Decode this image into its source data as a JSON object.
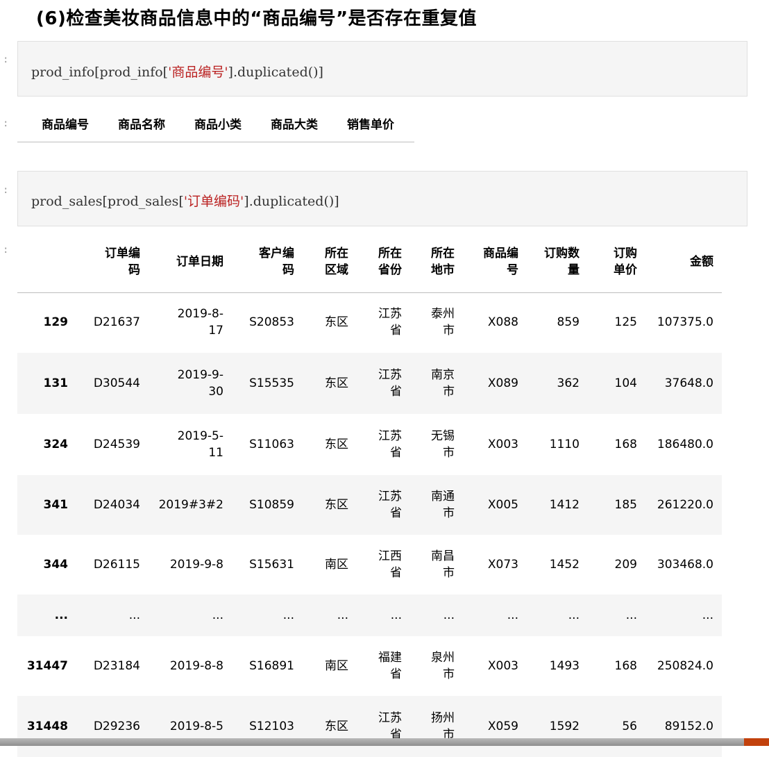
{
  "heading": "(6)检查美妆商品信息中的“商品编号”是否存在重复值",
  "prompt_mark": ":",
  "cell1": {
    "prefix": "prod_info[prod_info[",
    "string": "'商品编号'",
    "suffix": "].duplicated()]"
  },
  "output1": {
    "columns": [
      "商品编号",
      "商品名称",
      "商品小类",
      "商品大类",
      "销售单价"
    ]
  },
  "cell2": {
    "prefix": "prod_sales[prod_sales[",
    "string": "'订单编码'",
    "suffix": "].duplicated()]"
  },
  "output2": {
    "headers": [
      [
        "订单编",
        "码"
      ],
      [
        "订单日期"
      ],
      [
        "客户编",
        "码"
      ],
      [
        "所在",
        "区域"
      ],
      [
        "所在",
        "省份"
      ],
      [
        "所在",
        "地市"
      ],
      [
        "商品编",
        "号"
      ],
      [
        "订购数",
        "量"
      ],
      [
        "订购",
        "单价"
      ],
      [
        "金额"
      ]
    ],
    "rows": [
      {
        "index": "129",
        "cells": [
          [
            "D21637"
          ],
          [
            "2019-8-",
            "17"
          ],
          [
            "S20853"
          ],
          [
            "东区"
          ],
          [
            "江苏",
            "省"
          ],
          [
            "泰州",
            "市"
          ],
          [
            "X088"
          ],
          [
            "859"
          ],
          [
            "125"
          ],
          [
            "107375.0"
          ]
        ]
      },
      {
        "index": "131",
        "cells": [
          [
            "D30544"
          ],
          [
            "2019-9-",
            "30"
          ],
          [
            "S15535"
          ],
          [
            "东区"
          ],
          [
            "江苏",
            "省"
          ],
          [
            "南京",
            "市"
          ],
          [
            "X089"
          ],
          [
            "362"
          ],
          [
            "104"
          ],
          [
            "37648.0"
          ]
        ]
      },
      {
        "index": "324",
        "cells": [
          [
            "D24539"
          ],
          [
            "2019-5-",
            "11"
          ],
          [
            "S11063"
          ],
          [
            "东区"
          ],
          [
            "江苏",
            "省"
          ],
          [
            "无锡",
            "市"
          ],
          [
            "X003"
          ],
          [
            "1110"
          ],
          [
            "168"
          ],
          [
            "186480.0"
          ]
        ]
      },
      {
        "index": "341",
        "cells": [
          [
            "D24034"
          ],
          [
            "2019#3#2"
          ],
          [
            "S10859"
          ],
          [
            "东区"
          ],
          [
            "江苏",
            "省"
          ],
          [
            "南通",
            "市"
          ],
          [
            "X005"
          ],
          [
            "1412"
          ],
          [
            "185"
          ],
          [
            "261220.0"
          ]
        ]
      },
      {
        "index": "344",
        "cells": [
          [
            "D26115"
          ],
          [
            "2019-9-8"
          ],
          [
            "S15631"
          ],
          [
            "南区"
          ],
          [
            "江西",
            "省"
          ],
          [
            "南昌",
            "市"
          ],
          [
            "X073"
          ],
          [
            "1452"
          ],
          [
            "209"
          ],
          [
            "303468.0"
          ]
        ]
      },
      {
        "index": "...",
        "cells": [
          [
            "..."
          ],
          [
            "..."
          ],
          [
            "..."
          ],
          [
            "..."
          ],
          [
            "..."
          ],
          [
            "..."
          ],
          [
            "..."
          ],
          [
            "..."
          ],
          [
            "..."
          ],
          [
            "..."
          ]
        ]
      },
      {
        "index": "31447",
        "cells": [
          [
            "D23184"
          ],
          [
            "2019-8-8"
          ],
          [
            "S16891"
          ],
          [
            "南区"
          ],
          [
            "福建",
            "省"
          ],
          [
            "泉州",
            "市"
          ],
          [
            "X003"
          ],
          [
            "1493"
          ],
          [
            "168"
          ],
          [
            "250824.0"
          ]
        ]
      },
      {
        "index": "31448",
        "cells": [
          [
            "D29236"
          ],
          [
            "2019-8-5"
          ],
          [
            "S12103"
          ],
          [
            "东区"
          ],
          [
            "江苏",
            "省"
          ],
          [
            "扬州",
            "市"
          ],
          [
            "X059"
          ],
          [
            "1592"
          ],
          [
            "56"
          ],
          [
            "89152.0"
          ]
        ]
      }
    ]
  },
  "colors": {
    "code_bg": "#f5f5f5",
    "string": "#ba2121",
    "stripe": "#f5f5f5",
    "accent": "#c2410c"
  }
}
